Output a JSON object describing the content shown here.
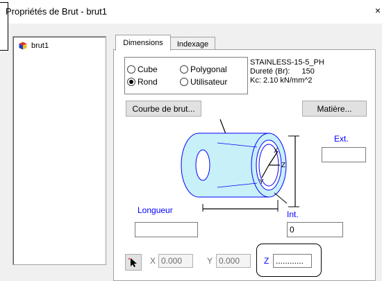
{
  "window": {
    "title": "Propriétés de Brut - brut1",
    "close_glyph": "×"
  },
  "tree": {
    "items": [
      {
        "label": "brut1",
        "icon": "cube-icon"
      }
    ]
  },
  "tabs": [
    {
      "label": "Dimensions",
      "active": true
    },
    {
      "label": "Indexage",
      "active": false
    }
  ],
  "shape": {
    "options": [
      {
        "label": "Cube",
        "checked": false
      },
      {
        "label": "Polygonal",
        "checked": false
      },
      {
        "label": "Rond",
        "checked": true
      },
      {
        "label": "Utilisateur",
        "checked": false
      }
    ]
  },
  "material": {
    "name": "STAINLESS-15-5_PH",
    "hardness_label": "Dureté (Br):",
    "hardness_value": "150",
    "kc": "Kc: 2.10 kN/mm^2"
  },
  "buttons": {
    "courbe": "Courbe de brut...",
    "matiere": "Matière..."
  },
  "fields": {
    "ext_label": "Ext.",
    "ext_value": "",
    "int_label": "Int.",
    "int_value": "0",
    "longueur_label": "Longueur",
    "longueur_value": ""
  },
  "coords": {
    "x_label": "X",
    "x_value": "0.000",
    "y_label": "Y",
    "y_value": "0.000",
    "z_label": "Z",
    "z_value": "............"
  },
  "colors": {
    "accent_blue": "#0000ff",
    "cylinder_fill": "#c8f0f8",
    "cylinder_stroke": "#0000ff"
  }
}
